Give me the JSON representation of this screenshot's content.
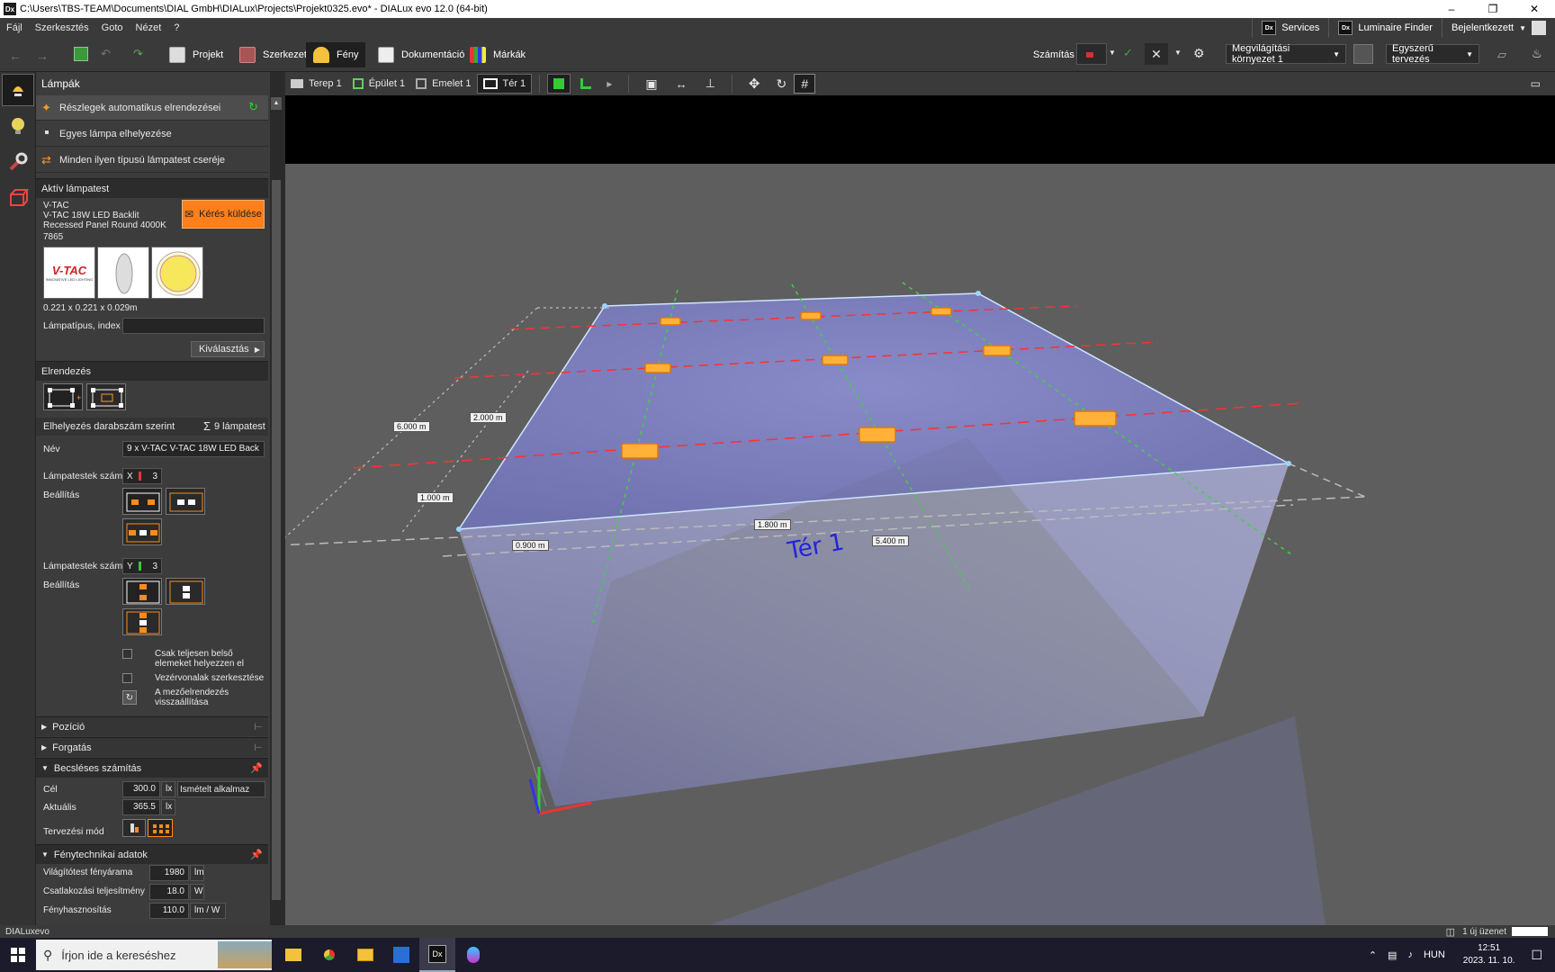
{
  "title_bar": {
    "app_badge": "Dx",
    "title": "C:\\Users\\TBS-TEAM\\Documents\\DIAL GmbH\\DIALux\\Projects\\Projekt0325.evo* - DIALux evo 12.0  (64-bit)"
  },
  "menu": {
    "items": [
      "Fájl",
      "Szerkesztés",
      "Goto",
      "Nézet",
      "?"
    ],
    "services": "Services",
    "luminaire_finder": "Luminaire Finder",
    "login": "Bejelentkezett",
    "dx_badge": "Dx"
  },
  "toolbar": {
    "tabs": [
      {
        "label": "Projekt"
      },
      {
        "label": "Szerkezet"
      },
      {
        "label": "Fény"
      },
      {
        "label": "Dokumentáció"
      },
      {
        "label": "Márkák"
      }
    ],
    "calc_label": "Számítás",
    "lighting_env": "Megvilágítási környezet 1",
    "design_mode": "Egyszerű tervezés"
  },
  "panel": {
    "title": "Lámpák",
    "modes": [
      "Részlegek automatikus elrendezései",
      "Egyes lámpa elhelyezése",
      "Minden ilyen típusú lámpatest cseréje"
    ],
    "active_lum": {
      "header": "Aktív lámpatest",
      "brand": "V-TAC",
      "name": "V-TAC 18W LED Backlit Recessed Panel Round 4000K",
      "code": "7865",
      "request_btn": "Kérés küldése",
      "logo_text": "V-TAC",
      "logo_sub": "INNOVATIVE LED LIGHTING",
      "dims": "0.221 x 0.221 x 0.029m",
      "type_label": "Lámpatípus, index",
      "select_btn": "Kiválasztás"
    },
    "arrangement": {
      "header": "Elrendezés",
      "count_label": "Elhelyezés darabszám szerint",
      "count_value": "9 lámpatest",
      "name_label": "Név",
      "name_value": "9 x V-TAC V-TAC 18W LED Back",
      "nx_label": "Lámpatestek száma",
      "nx_axis": "X",
      "nx_value": "3",
      "set_label_x": "Beállítás",
      "ny_label": "Lámpatestek száma",
      "ny_axis": "Y",
      "ny_value": "3",
      "set_label_y": "Beállítás",
      "check1": "Csak teljesen belső elemeket helyezzen el",
      "check2": "Vezérvonalak szerkesztése",
      "check3": "A mezőelrendezés visszaállítása"
    },
    "position": "Pozíció",
    "rotate": "Forgatás",
    "estimate": {
      "header": "Becsléses számítás",
      "target_label": "Cél",
      "target_value": "300.0",
      "unit": "lx",
      "apply_btn": "Ismételt alkalmaz",
      "actual_label": "Aktuális",
      "actual_value": "365.5",
      "mode_label": "Tervezési mód"
    },
    "photometric": {
      "header": "Fénytechnikai adatok",
      "flux_label": "Világítótest fényárama",
      "flux_value": "1980",
      "flux_unit": "lm",
      "power_label": "Csatlakozási teljesítmény",
      "power_value": "18.0",
      "power_unit": "W",
      "eff_label": "Fényhasznosítás",
      "eff_value": "110.0",
      "eff_unit": "lm / W"
    }
  },
  "view": {
    "breadcrumbs": [
      "Terep 1",
      "Épület 1",
      "Emelet 1",
      "Tér 1"
    ],
    "room_label": "Tér 1",
    "dimensions": [
      "6.000 m",
      "2.000 m",
      "1.000 m",
      "0.900 m",
      "1.800 m",
      "5.400 m"
    ]
  },
  "status": {
    "brand": "DIALux",
    "brand_suffix": "evo",
    "messages": "1 új üzenet"
  },
  "taskbar": {
    "search_placeholder": "Írjon ide a kereséshez",
    "lang": "HUN",
    "time": "12:51",
    "date": "2023. 11. 10."
  },
  "colors": {
    "accent_orange": "#ff7f1a",
    "room_blue": "#7a7fc0",
    "grid_red": "#ff3030",
    "grid_green": "#3fd23f"
  }
}
